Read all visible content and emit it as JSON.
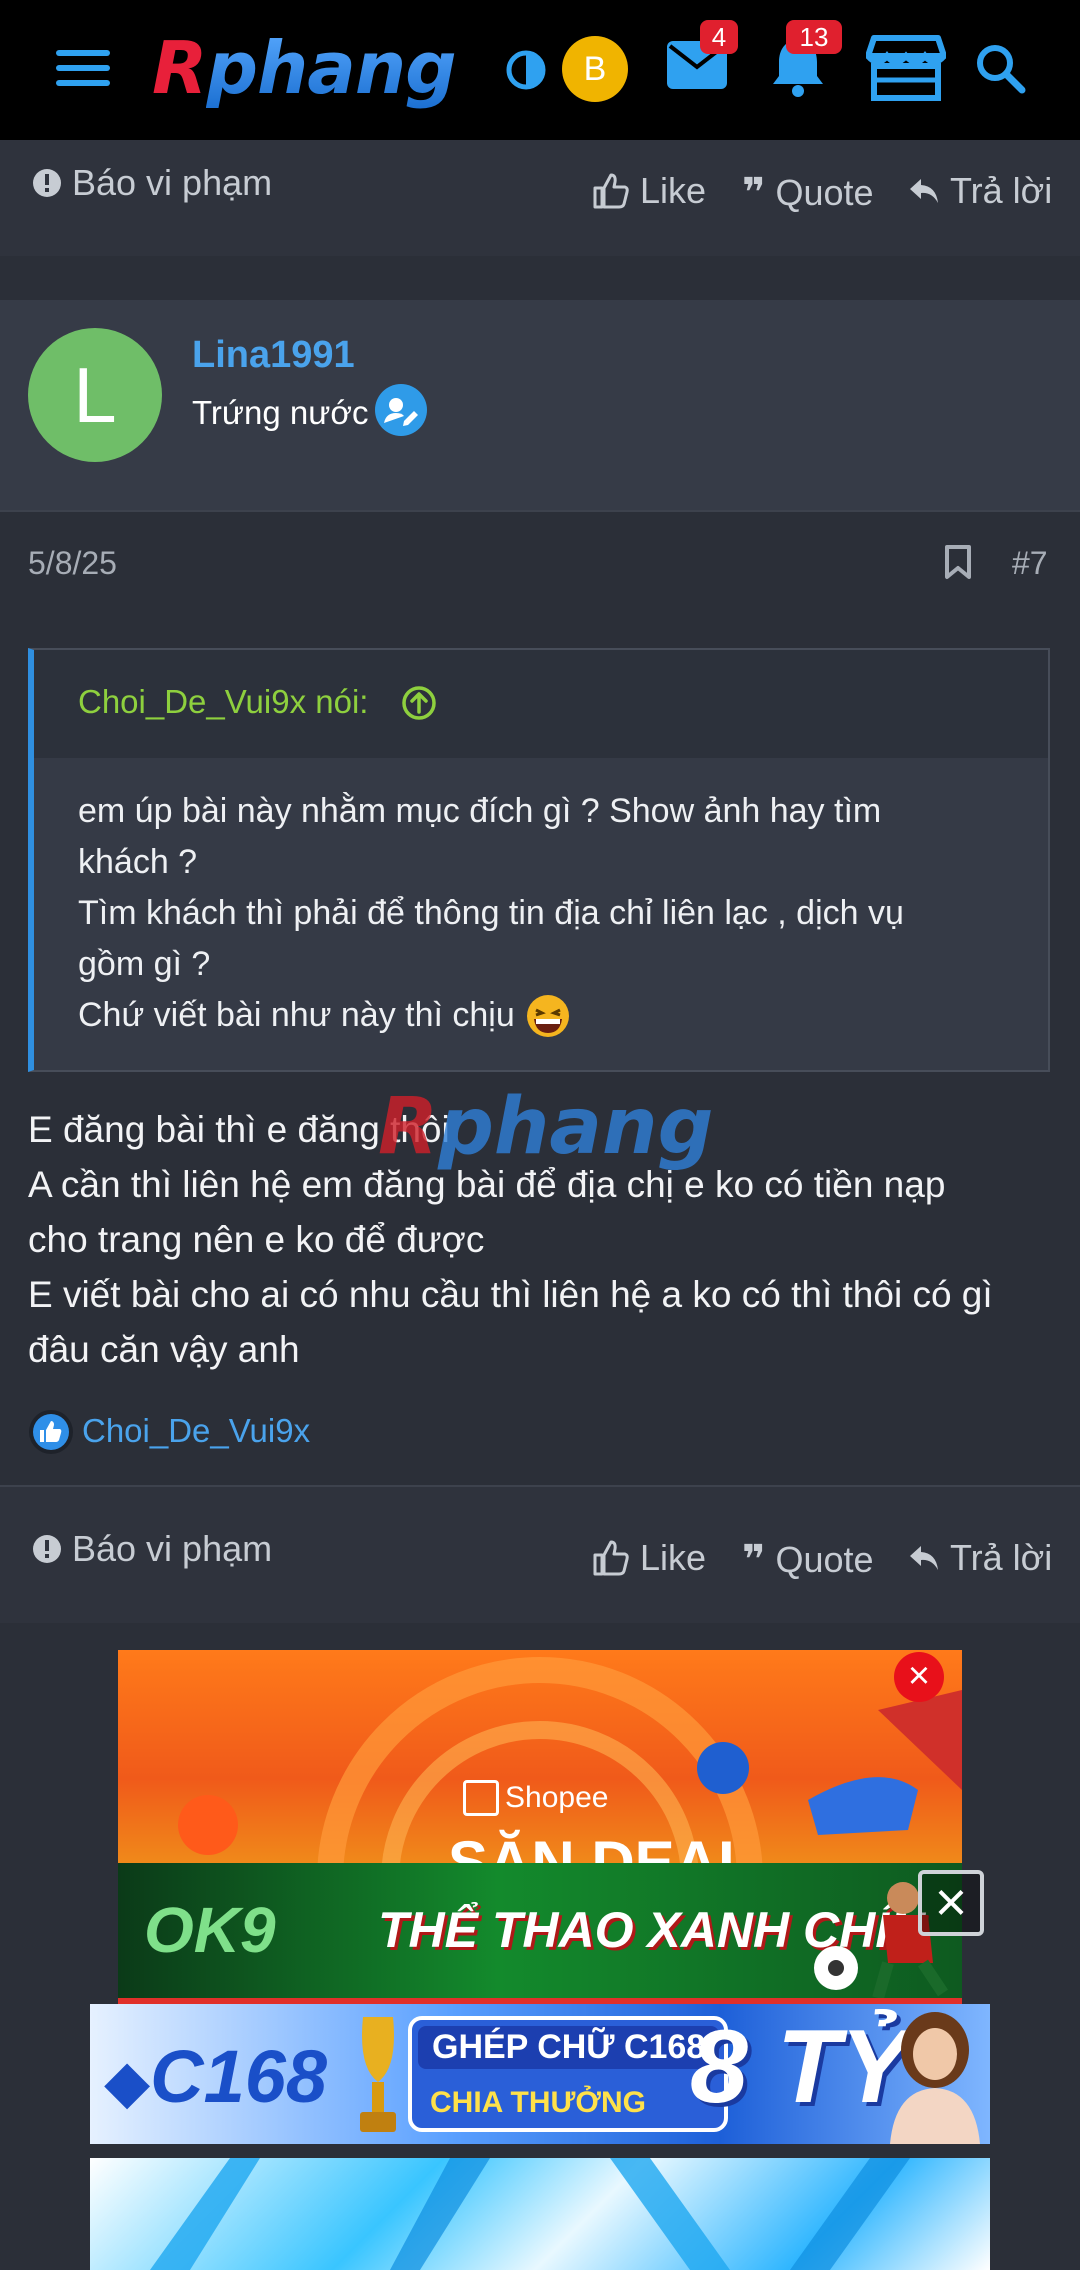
{
  "header": {
    "logo_part1": "R",
    "logo_part2": "phang",
    "user_initial": "B",
    "messages_count": "4",
    "alerts_count": "13",
    "colors": {
      "background": "#000000",
      "accent": "#2fa1f0",
      "badge": "#e0202e"
    },
    "icons": [
      "menu-icon",
      "theme-toggle-icon",
      "mail-icon",
      "bell-icon",
      "store-icon",
      "search-icon"
    ]
  },
  "prev_actions": {
    "report": "Báo vi phạm",
    "like": "Like",
    "quote": "Quote",
    "reply": "Trả lời"
  },
  "post": {
    "author": {
      "initial": "L",
      "name": "Lina1991",
      "title": "Trứng nước"
    },
    "date": "5/8/25",
    "number": "#7",
    "quote": {
      "author": "Choi_De_Vui9x nói:",
      "lines": [
        "em úp bài này nhằm mục đích gì ? Show ảnh hay tìm",
        "khách ?",
        "Tìm khách thì phải để thông tin địa chỉ liên lạc , dịch vụ",
        "gồm gì ?",
        "Chứ viết bài như này thì chịu"
      ]
    },
    "body_lines": [
      "E đăng bài thì e đăng thôi",
      "A cần thì liên hệ em đăng bài để địa chị e ko có tiền nạp",
      "cho trang nên e ko để được",
      "E viết bài cho ai có nhu cầu thì liên hệ a ko có thì thôi có gì",
      "đâu căn vậy anh"
    ],
    "likers": "Choi_De_Vui9x",
    "actions": {
      "report": "Báo vi phạm",
      "like": "Like",
      "quote": "Quote",
      "reply": "Trả lời"
    }
  },
  "ads": {
    "shopee_brand": "Shopee",
    "shopee_text": "SĂN DEAL",
    "ok9_brand": "OK9",
    "ok9_text": "THỂ THAO XANH CHÍN",
    "c168_brand": "C168",
    "c168_line1": "GHÉP CHỮ C168",
    "c168_line2": "CHIA THƯỞNG",
    "c168_amount": "8 TỶ",
    "close_symbol": "×"
  }
}
